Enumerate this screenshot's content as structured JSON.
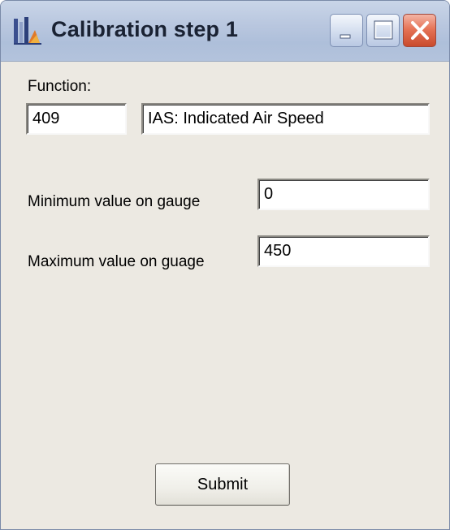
{
  "window": {
    "title": "Calibration step 1",
    "icons": {
      "app": "gauge-app-icon",
      "minimize": "minimize-icon",
      "maximize": "maximize-icon",
      "close": "close-icon"
    },
    "colors": {
      "titlebar": "#b9c7df",
      "client_background": "#ece9e2",
      "close_button": "#e67457"
    }
  },
  "form": {
    "function_label": "Function:",
    "function_code": "409",
    "function_name": "IAS: Indicated Air Speed",
    "min_label": "Minimum value on gauge",
    "min_value": "0",
    "max_label": "Maximum value on guage",
    "max_value": "450",
    "submit_label": "Submit"
  }
}
